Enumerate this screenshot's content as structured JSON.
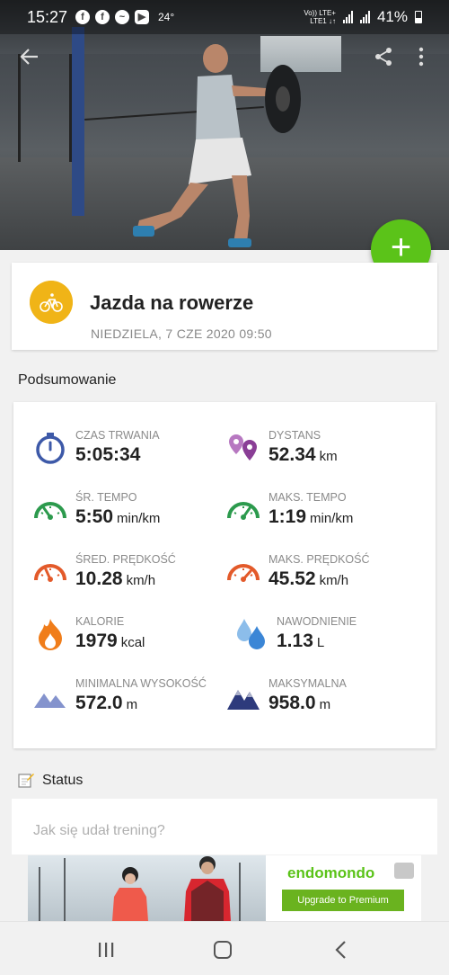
{
  "status_bar": {
    "time": "15:27",
    "temperature": "24°",
    "network_top": "Vo)) LTE+",
    "network_bottom": "LTE1 ↓↑",
    "battery": "41%"
  },
  "activity": {
    "sport": "Jazda na rowerze",
    "date": "NIEDZIELA, 7 CZE 2020 09:50"
  },
  "summary": {
    "title": "Podsumowanie",
    "stats": [
      {
        "label": "CZAS TRWANIA",
        "value": "5:05:34",
        "unit": "",
        "icon": "stopwatch-icon",
        "color": "#3d59a8"
      },
      {
        "label": "DYSTANS",
        "value": "52.34",
        "unit": "km",
        "icon": "location-pins-icon",
        "color": "#8a3e96"
      },
      {
        "label": "ŚR. TEMPO",
        "value": "5:50",
        "unit": "min/km",
        "icon": "speedometer-icon",
        "color": "#2c9a4d"
      },
      {
        "label": "MAKS. TEMPO",
        "value": "1:19",
        "unit": "min/km",
        "icon": "speedometer-icon",
        "color": "#2c9a4d"
      },
      {
        "label": "ŚRED. PRĘDKOŚĆ",
        "value": "10.28",
        "unit": "km/h",
        "icon": "speedometer-icon",
        "color": "#e35a2a"
      },
      {
        "label": "MAKS. PRĘDKOŚĆ",
        "value": "45.52",
        "unit": "km/h",
        "icon": "speedometer-icon",
        "color": "#e35a2a"
      },
      {
        "label": "KALORIE",
        "value": "1979",
        "unit": "kcal",
        "icon": "flame-icon",
        "color": "#f07d1a"
      },
      {
        "label": "NAWODNIENIE",
        "value": "1.13",
        "unit": "L",
        "icon": "water-drops-icon",
        "color": "#4a90d9"
      },
      {
        "label": "MINIMALNA WYSOKOŚĆ",
        "value": "572.0",
        "unit": "m",
        "icon": "mountains-icon",
        "color": "#6d7fc0"
      },
      {
        "label": "MAKSYMALNA",
        "value": "958.0",
        "unit": "m",
        "icon": "mountains-icon",
        "color": "#2d3a7c"
      }
    ]
  },
  "status": {
    "title": "Status",
    "placeholder": "Jak się udał trening?"
  },
  "ad": {
    "brand_prefix": "",
    "brand": "endomondo",
    "button": "Upgrade to Premium"
  },
  "colors": {
    "accent": "#5bc319",
    "sport": "#f0b417"
  }
}
